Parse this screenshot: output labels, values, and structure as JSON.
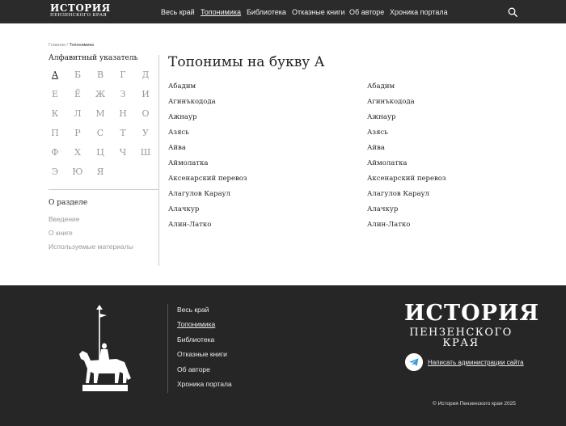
{
  "header": {
    "logo_line1": "ИСТОРИЯ",
    "logo_line2": "ПЕНЗЕНСКОГО КРАЯ",
    "nav": [
      {
        "label": "Весь край",
        "active": false
      },
      {
        "label": "Топонимика",
        "active": true
      },
      {
        "label": "Библиотека",
        "active": false
      },
      {
        "label": "Отказные книги",
        "active": false
      },
      {
        "label": "Об авторе",
        "active": false
      },
      {
        "label": "Хроника портала",
        "active": false
      }
    ],
    "search_icon": "search-icon"
  },
  "breadcrumb": {
    "home": "Главная",
    "separator": "/",
    "current": "Топонимика"
  },
  "sidebar": {
    "title": "Алфавитный указатель",
    "letters": [
      "А",
      "Б",
      "В",
      "Г",
      "Д",
      "Е",
      "Ё",
      "Ж",
      "З",
      "И",
      "К",
      "Л",
      "М",
      "Н",
      "О",
      "П",
      "Р",
      "С",
      "Т",
      "У",
      "Ф",
      "Х",
      "Ц",
      "Ч",
      "Ш",
      "Э",
      "Ю",
      "Я"
    ],
    "active_letter": "А",
    "about_title": "О разделе",
    "about_links": [
      "Введение",
      "О книге",
      "Используемые материалы"
    ]
  },
  "main": {
    "title": "Топонимы на букву А",
    "column_left": [
      "Абадим",
      "Агинъкодода",
      "Ажнаур",
      "Азясь",
      "Айва",
      "Аймолатка",
      "Аксенарский перевоз",
      "Алагулов Караул",
      "Алачкур",
      "Алин-Латко"
    ],
    "column_right": [
      "Абадим",
      "Агинъкодода",
      "Ажнаур",
      "Азясь",
      "Айва",
      "Аймолатка",
      "Аксенарский перевоз",
      "Алагулов Караул",
      "Алачкур",
      "Алин-Латко"
    ]
  },
  "footer": {
    "nav": [
      {
        "label": "Весь край",
        "active": false
      },
      {
        "label": "Топонимика",
        "active": true
      },
      {
        "label": "Библиотека",
        "active": false
      },
      {
        "label": "Отказные книги",
        "active": false
      },
      {
        "label": "Об авторе",
        "active": false
      },
      {
        "label": "Хроника портала",
        "active": false
      }
    ],
    "logo_line1": "ИСТОРИЯ",
    "logo_line2": "ПЕНЗЕНСКОГО КРАЯ",
    "contact_link": "Написать администрации сайта",
    "contact_icon": "telegram-icon",
    "copyright": "© История Пензенского края 2025"
  },
  "colors": {
    "header_bg": "#2b2b2b",
    "footer_bg": "#262626",
    "text": "#222222",
    "muted": "#999999"
  }
}
